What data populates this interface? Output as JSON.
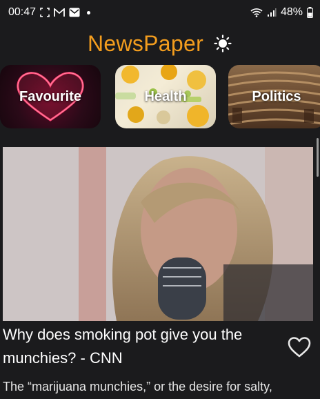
{
  "status_bar": {
    "time": "00:47",
    "battery": "48%",
    "icons": [
      "screenshot-frame-icon",
      "gmail-icon",
      "mail-icon",
      "notification-dot-icon",
      "wifi-icon",
      "signal-icon",
      "battery-icon"
    ]
  },
  "header": {
    "title": "NewsPaper",
    "theme_icon": "sun-icon"
  },
  "categories": [
    {
      "label": "Favourite"
    },
    {
      "label": "Health"
    },
    {
      "label": "Politics"
    }
  ],
  "article": {
    "title": "Why does smoking pot give you the munchies? - CNN",
    "summary": "The “marijuana munchies,” or the desire for salty,",
    "favorite_icon": "heart-outline-icon"
  },
  "colors": {
    "background": "#1b1b1d",
    "accent": "#f39d1e",
    "text": "#ffffff"
  }
}
